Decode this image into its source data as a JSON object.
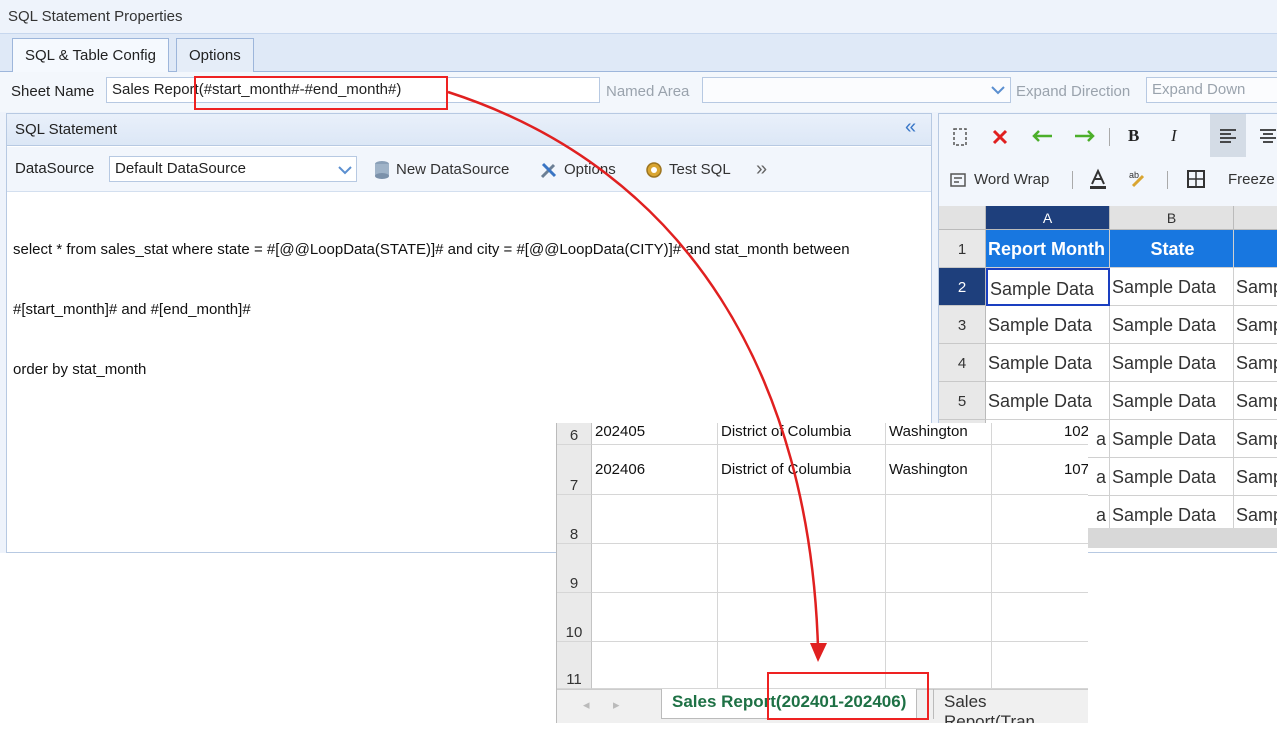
{
  "dialog": {
    "title": "SQL Statement Properties"
  },
  "tabs": [
    {
      "label": "SQL & Table Config"
    },
    {
      "label": "Options"
    }
  ],
  "sheet_row": {
    "sheet_name_label": "Sheet Name",
    "sheet_name_value": "Sales Report(#start_month#-#end_month#)",
    "named_area_label": "Named Area",
    "named_area_value": "",
    "expand_direction_label": "Expand Direction",
    "expand_direction_value": "Expand Down"
  },
  "sql_panel": {
    "title": "SQL Statement",
    "collapse_glyph": "«",
    "datasource_label": "DataSource",
    "datasource_value": "Default DataSource",
    "new_datasource": "New DataSource",
    "options": "Options",
    "test_sql": "Test SQL",
    "more": "»",
    "sql_lines": [
      "select * from sales_stat where state = #[@@LoopData(STATE)]# and city = #[@@LoopData(CITY)]# and stat_month between",
      "#[start_month]# and #[end_month]#",
      "order by stat_month"
    ]
  },
  "preview": {
    "toolbar": {
      "word_wrap": "Word Wrap",
      "freeze": "Freeze"
    },
    "columns": [
      "A",
      "B"
    ],
    "header_row": [
      "Report Month",
      "State"
    ],
    "rows": [
      {
        "num": "2",
        "cells": [
          "Sample Data",
          "Sample Data",
          "Samp"
        ]
      },
      {
        "num": "3",
        "cells": [
          "Sample Data",
          "Sample Data",
          "Samp"
        ]
      },
      {
        "num": "4",
        "cells": [
          "Sample Data",
          "Sample Data",
          "Samp"
        ]
      },
      {
        "num": "5",
        "cells": [
          "Sample Data",
          "Sample Data",
          "Samp"
        ]
      },
      {
        "num": "",
        "cells": [
          "a",
          "Sample Data",
          "Samp"
        ]
      },
      {
        "num": "",
        "cells": [
          "a",
          "Sample Data",
          "Samp"
        ]
      },
      {
        "num": "",
        "cells": [
          "a",
          "Sample Data",
          "Samp"
        ]
      }
    ],
    "header_row_num": "1"
  },
  "excel": {
    "rows": [
      {
        "num": "6",
        "cells": [
          "202405",
          "District of Columbia",
          "Washington",
          "102"
        ]
      },
      {
        "num": "7",
        "cells": [
          "202406",
          "District of Columbia",
          "Washington",
          "107"
        ]
      },
      {
        "num": "8",
        "cells": [
          "",
          "",
          "",
          ""
        ]
      },
      {
        "num": "9",
        "cells": [
          "",
          "",
          "",
          ""
        ]
      },
      {
        "num": "10",
        "cells": [
          "",
          "",
          "",
          ""
        ]
      },
      {
        "num": "11",
        "cells": [
          "",
          "",
          "",
          ""
        ]
      }
    ],
    "active_sheet": "Sales Report(202401-202406)",
    "other_sheet": "Sales Report(Tran"
  },
  "colors": {
    "accent_blue": "#1a73d9",
    "highlight_red": "#e22222",
    "sheet_green": "#1e7145"
  }
}
